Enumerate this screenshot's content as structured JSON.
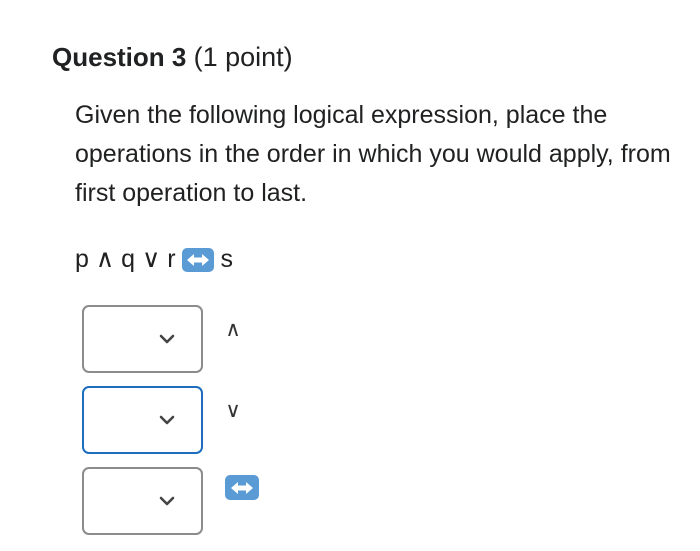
{
  "question": {
    "title": "Question 3",
    "points": "(1 point)",
    "prompt": "Given the following logical expression, place the operations in the order in which you would apply, from first operation to last.",
    "expression": {
      "part1": "p ∧ q ∨ r",
      "part2": "s",
      "biconditional_icon": "left-right-arrow-icon",
      "icon_color": "#5b9bd5"
    }
  },
  "answers": [
    {
      "selected": "",
      "operator": "∧"
    },
    {
      "selected": "",
      "operator": "∨"
    },
    {
      "selected": "",
      "operator_icon": "left-right-arrow-icon"
    }
  ],
  "colors": {
    "focus_border": "#1f6ebd",
    "select_border": "#8c8c8c"
  }
}
